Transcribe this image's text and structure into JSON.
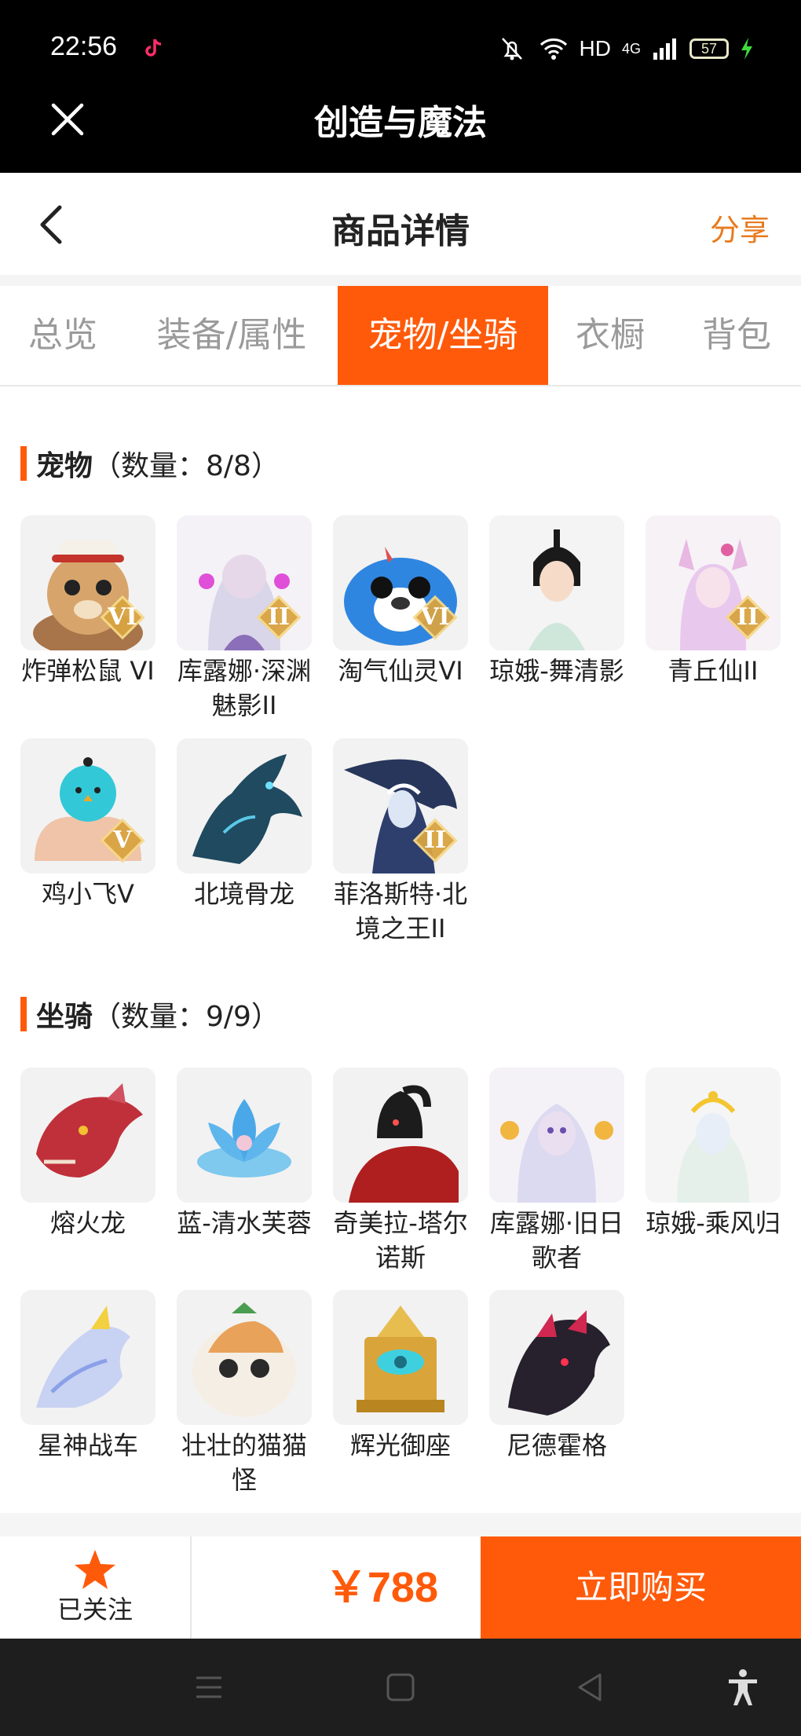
{
  "status_bar": {
    "time": "22:56",
    "hd": "HD",
    "network": "4G",
    "battery": "57"
  },
  "app_bar": {
    "title": "创造与魔法"
  },
  "page_header": {
    "title": "商品详情",
    "share": "分享"
  },
  "tabs": [
    {
      "label": "总览",
      "active": false
    },
    {
      "label": "装备/属性",
      "active": false
    },
    {
      "label": "宠物/坐骑",
      "active": true
    },
    {
      "label": "衣橱",
      "active": false
    },
    {
      "label": "背包",
      "active": false
    }
  ],
  "pets": {
    "title": "宠物",
    "count_text": "（数量：8/8）",
    "items": [
      {
        "name": "炸弹松鼠 VI",
        "grade": "VI",
        "icon": "squirrel-pet-icon"
      },
      {
        "name": "库露娜·深渊魅影II",
        "grade": "II",
        "icon": "kuluna-abyss-pet-icon"
      },
      {
        "name": "淘气仙灵VI",
        "grade": "VI",
        "icon": "blue-fairy-pet-icon"
      },
      {
        "name": "琼娥-舞清影",
        "grade": "",
        "icon": "qiong-e-dancer-pet-icon"
      },
      {
        "name": "青丘仙II",
        "grade": "II",
        "icon": "qingqiu-fox-pet-icon"
      },
      {
        "name": "鸡小飞V",
        "grade": "V",
        "icon": "chick-pet-icon"
      },
      {
        "name": "北境骨龙",
        "grade": "",
        "icon": "bone-dragon-pet-icon"
      },
      {
        "name": "菲洛斯特·北境之王II",
        "grade": "II",
        "icon": "frost-king-pet-icon"
      }
    ]
  },
  "mounts": {
    "title": "坐骑",
    "count_text": "（数量：9/9）",
    "items": [
      {
        "name": "熔火龙",
        "icon": "lava-dragon-mount-icon"
      },
      {
        "name": "蓝-清水芙蓉",
        "icon": "blue-lotus-mount-icon"
      },
      {
        "name": "奇美拉-塔尔诺斯",
        "icon": "chimera-mount-icon"
      },
      {
        "name": "库露娜·旧日歌者",
        "icon": "kuluna-singer-mount-icon"
      },
      {
        "name": "琼娥-乘风归",
        "icon": "qiong-e-wind-mount-icon"
      },
      {
        "name": "星神战车",
        "icon": "star-chariot-mount-icon"
      },
      {
        "name": "壮壮的猫猫怪",
        "icon": "chubby-cat-mount-icon"
      },
      {
        "name": "辉光御座",
        "icon": "radiant-throne-mount-icon"
      },
      {
        "name": "尼德霍格",
        "icon": "nidhogg-mount-icon"
      }
    ]
  },
  "action_bar": {
    "follow_label": "已关注",
    "price": "￥788",
    "buy_label": "立即购买"
  },
  "colors": {
    "accent": "#ff5a0a",
    "share": "#e87a1e",
    "tab_inactive": "#9a9a9a"
  }
}
